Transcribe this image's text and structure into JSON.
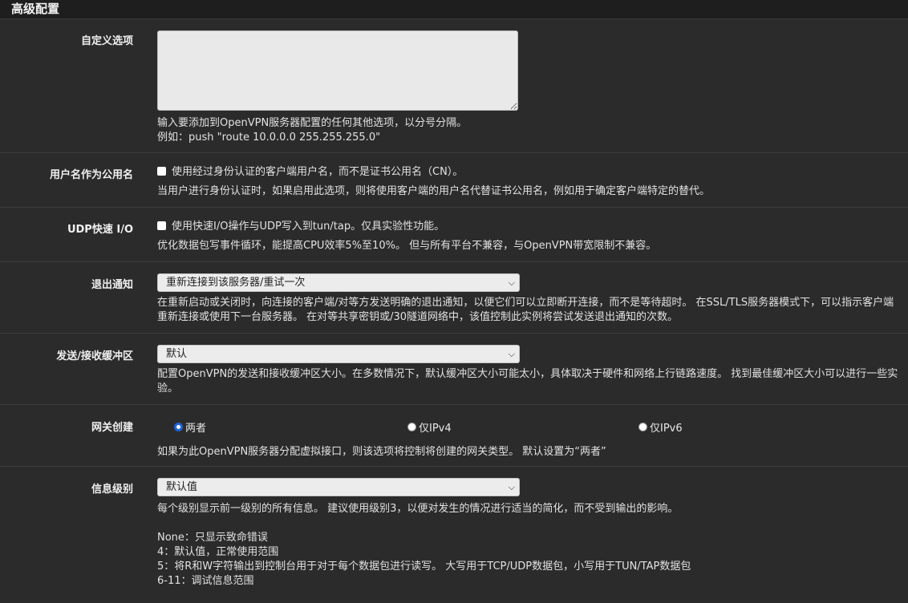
{
  "panel": {
    "title": "高级配置"
  },
  "custom_options": {
    "label": "自定义选项",
    "value": "",
    "help1": "输入要添加到OpenVPN服务器配置的任何其他选项，以分号分隔。",
    "help2": "例如：push \"route 10.0.0.0 255.255.255.0\""
  },
  "username_as_cn": {
    "label": "用户名作为公用名",
    "checkbox": "使用经过身份认证的客户端用户名，而不是证书公用名（CN）。",
    "checked": false,
    "help": "当用户进行身份认证时，如果启用此选项，则将使用客户端的用户名代替证书公用名，例如用于确定客户端特定的替代。"
  },
  "udp_fast_io": {
    "label": "UDP快速 I/O",
    "checkbox": "使用快速I/O操作与UDP写入到tun/tap。仅具实验性功能。",
    "checked": false,
    "help": "优化数据包写事件循环，能提高CPU效率5%至10%。 但与所有平台不兼容，与OpenVPN带宽限制不兼容。"
  },
  "exit_notify": {
    "label": "退出通知",
    "selected": "重新连接到该服务器/重试一次",
    "help": "在重新启动或关闭时，向连接的客户端/对等方发送明确的退出通知，以便它们可以立即断开连接，而不是等待超时。 在SSL/TLS服务器模式下，可以指示客户端重新连接或使用下一台服务器。 在对等共享密钥或/30隧道网络中，该值控制此实例将尝试发送退出通知的次数。"
  },
  "buffer": {
    "label": "发送/接收缓冲区",
    "selected": "默认",
    "help": "配置OpenVPN的发送和接收缓冲区大小。在多数情况下，默认缓冲区大小可能太小，具体取决于硬件和网络上行链路速度。 找到最佳缓冲区大小可以进行一些实验。"
  },
  "gateway": {
    "label": "网关创建",
    "options": [
      "两者",
      "仅IPv4",
      "仅IPv6"
    ],
    "selected": "两者",
    "help": "如果为此OpenVPN服务器分配虚拟接口，则该选项将控制将创建的网关类型。 默认设置为“两者”"
  },
  "verbosity": {
    "label": "信息级别",
    "selected": "默认值",
    "help": "每个级别显示前一级别的所有信息。 建议使用级别3，以便对发生的情况进行适当的简化，而不受到输出的影响。",
    "levels": [
      "None：只显示致命错误",
      "4：默认值，正常使用范围",
      "5：将R和W字符输出到控制台用于对于每个数据包进行读写。 大写用于TCP/UDP数据包，小写用于TUN/TAP数据包",
      "6-11：调试信息范围"
    ]
  }
}
